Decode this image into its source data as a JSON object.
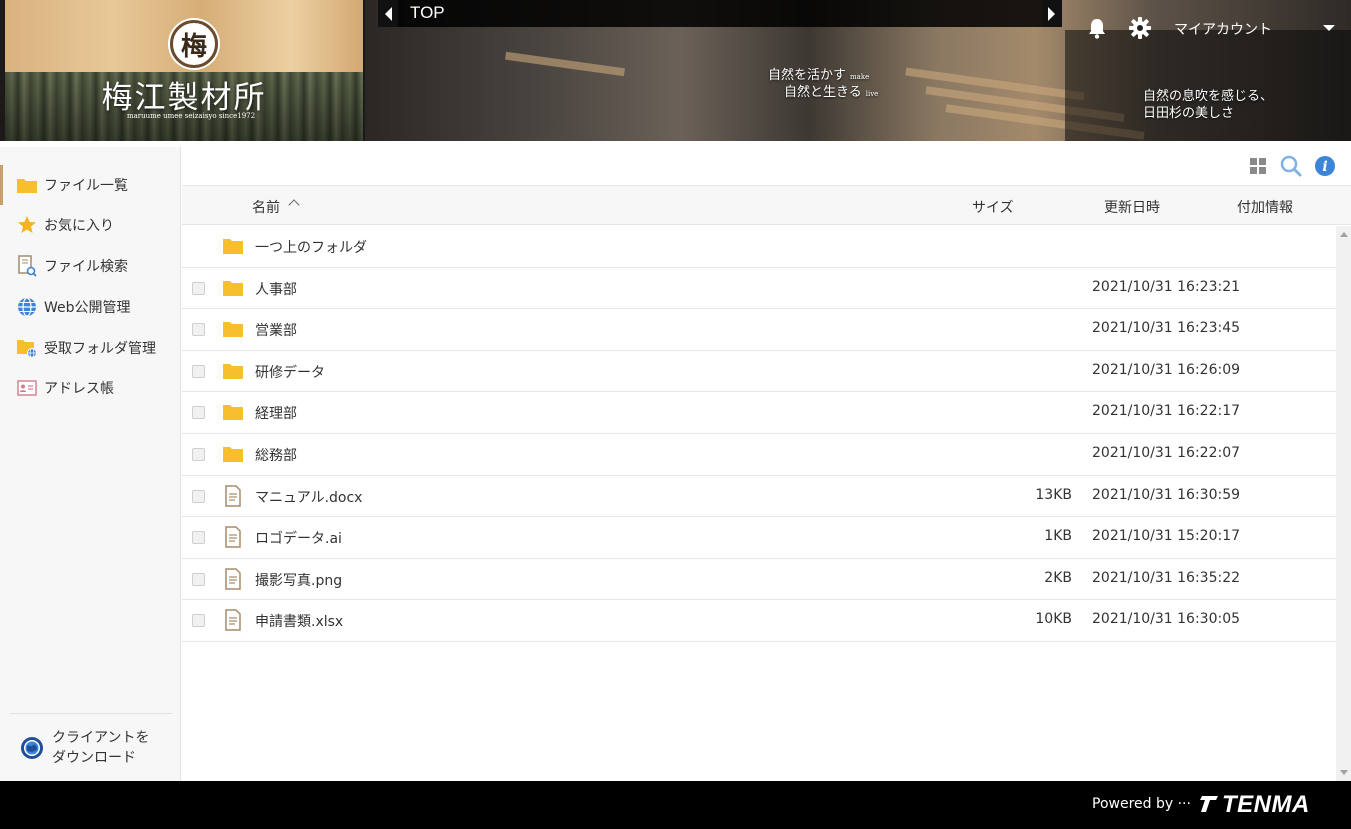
{
  "logo": {
    "mark": "梅",
    "title": "梅江製材所",
    "subtitle": "maruume umee seizaisyo since1972"
  },
  "banner": {
    "tagline1": "自然を活かす",
    "tagline1_small": "make",
    "tagline2": "自然と生きる",
    "tagline2_small": "live",
    "tagline3": "自然の息吹を感じる、",
    "tagline4": "日田杉の美しさ"
  },
  "topbar": {
    "title": "TOP",
    "prev_icon": "chevron-left-icon",
    "next_icon": "chevron-right-icon"
  },
  "header": {
    "notification_icon": "bell-icon",
    "settings_icon": "gear-icon",
    "account_label": "マイアカウント"
  },
  "sidebar": {
    "items": [
      {
        "label": "ファイル一覧",
        "icon": "folder-icon",
        "active": true
      },
      {
        "label": "お気に入り",
        "icon": "star-icon"
      },
      {
        "label": "ファイル検索",
        "icon": "file-search-icon"
      },
      {
        "label": "Web公開管理",
        "icon": "globe-icon"
      },
      {
        "label": "受取フォルダ管理",
        "icon": "folder-globe-icon"
      },
      {
        "label": "アドレス帳",
        "icon": "address-card-icon"
      }
    ],
    "client_download": {
      "line1": "クライアントを",
      "line2": "ダウンロード"
    }
  },
  "table": {
    "columns": {
      "name": "名前",
      "size": "サイズ",
      "modified": "更新日時",
      "extra": "付加情報"
    },
    "rows": [
      {
        "name": "一つ上のフォルダ",
        "type": "folder",
        "size": "",
        "modified": ""
      },
      {
        "name": "人事部",
        "type": "folder",
        "size": "",
        "modified": "2021/10/31 16:23:21"
      },
      {
        "name": "営業部",
        "type": "folder",
        "size": "",
        "modified": "2021/10/31 16:23:45"
      },
      {
        "name": "研修データ",
        "type": "folder",
        "size": "",
        "modified": "2021/10/31 16:26:09"
      },
      {
        "name": "経理部",
        "type": "folder",
        "size": "",
        "modified": "2021/10/31 16:22:17"
      },
      {
        "name": "総務部",
        "type": "folder",
        "size": "",
        "modified": "2021/10/31 16:22:07"
      },
      {
        "name": "マニュアル.docx",
        "type": "file",
        "size": "13KB",
        "modified": "2021/10/31 16:30:59"
      },
      {
        "name": "ロゴデータ.ai",
        "type": "file",
        "size": "1KB",
        "modified": "2021/10/31 15:20:17"
      },
      {
        "name": "撮影写真.png",
        "type": "file",
        "size": "2KB",
        "modified": "2021/10/31 16:35:22"
      },
      {
        "name": "申請書類.xlsx",
        "type": "file",
        "size": "10KB",
        "modified": "2021/10/31 16:30:05"
      }
    ]
  },
  "footer": {
    "powered_by": "Powered by ···",
    "brand": "TENMA"
  },
  "colors": {
    "folder": "#f8bf2c",
    "accent_border": "#c8a06c",
    "info_blue": "#3c84d8",
    "search_blue": "#7fb3e6"
  }
}
